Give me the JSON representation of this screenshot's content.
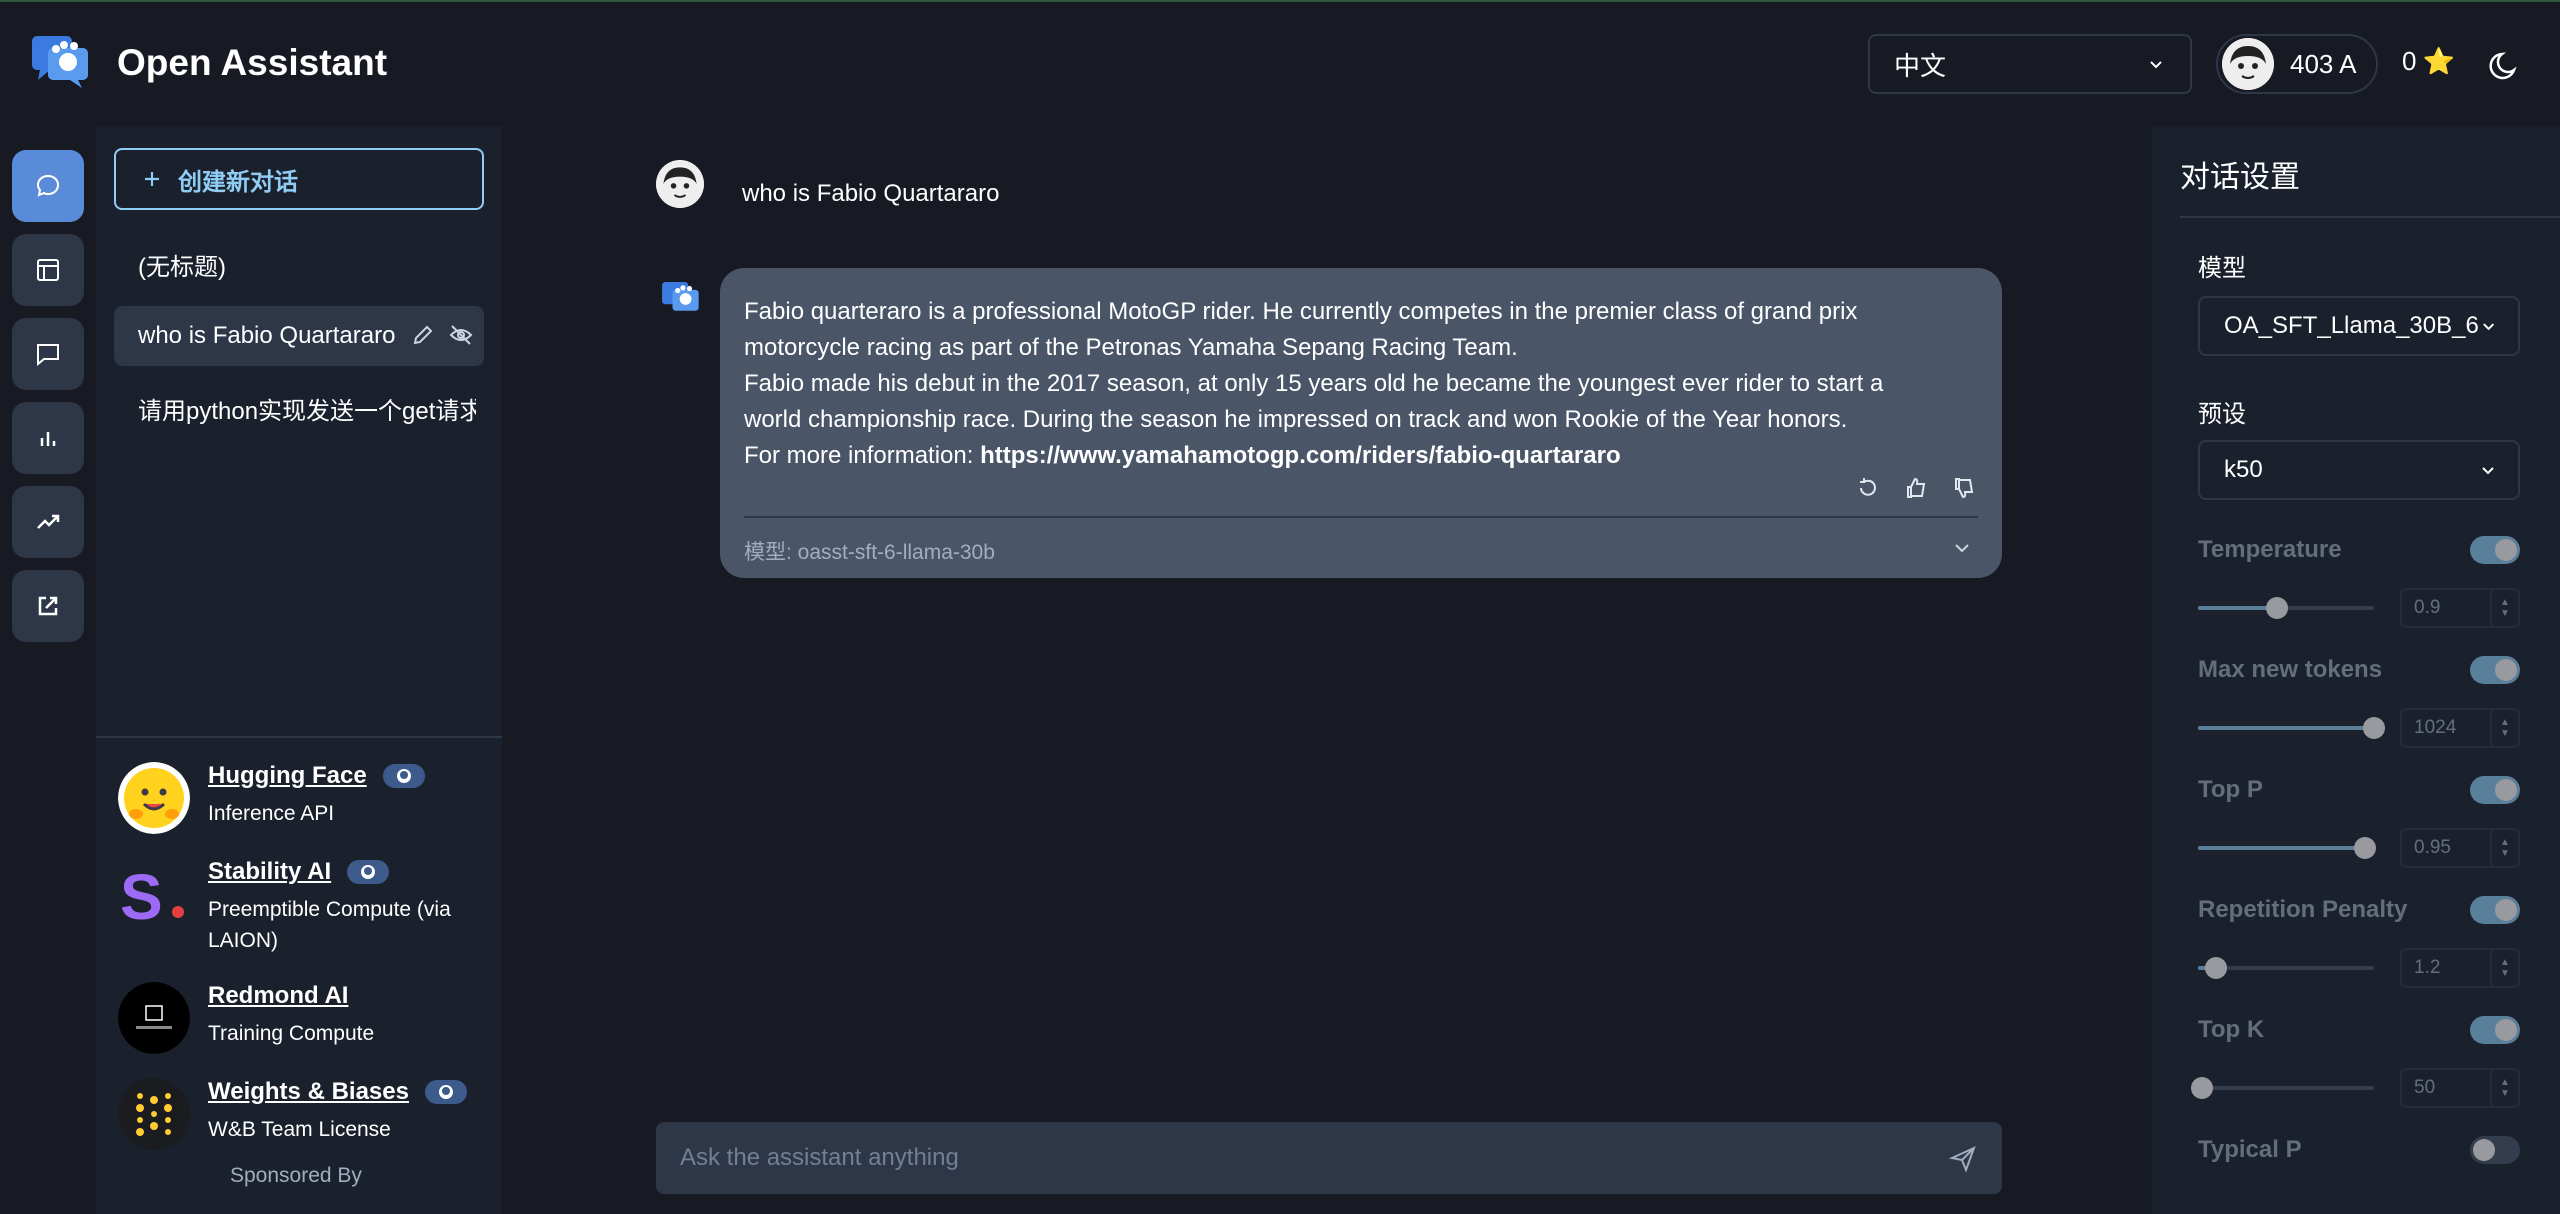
{
  "header": {
    "app_title": "Open Assistant",
    "language": "中文",
    "user_name": "403 A",
    "score": "0",
    "star": "⭐"
  },
  "sidebar": {
    "new_chat_label": "创建新对话",
    "chats": [
      {
        "title": "(无标题)"
      },
      {
        "title": "who is Fabio Quartararo"
      },
      {
        "title": "请用python实现发送一个get请求"
      }
    ],
    "sponsors": [
      {
        "name": "Hugging Face",
        "desc": "Inference API"
      },
      {
        "name": "Stability AI",
        "desc": "Preemptible Compute (via LAION)"
      },
      {
        "name": "Redmond AI",
        "desc": "Training Compute"
      },
      {
        "name": "Weights & Biases",
        "desc": "W&B Team License"
      }
    ],
    "sponsored_by": "Sponsored By"
  },
  "conversation": {
    "user_message": "who is Fabio Quartararo",
    "assistant_lines": [
      "Fabio quarteraro is a professional MotoGP rider. He currently competes in the premier class of grand prix",
      "motorcycle racing as part of the Petronas Yamaha Sepang Racing Team.",
      "Fabio made his debut in the 2017 season, at only 15 years old he became the youngest ever rider to start a",
      "world championship race. During the season he impressed on track and won Rookie of the Year honors."
    ],
    "more_info_prefix": "For more information: ",
    "more_info_link": "https://www.yamahamotogp.com/riders/fabio-quartararo",
    "model_label": "模型: oasst-sft-6-llama-30b",
    "composer_placeholder": "Ask the assistant anything"
  },
  "settings": {
    "title": "对话设置",
    "model_label": "模型",
    "model_value": "OA_SFT_Llama_30B_6",
    "preset_label": "预设",
    "preset_value": "k50",
    "params": [
      {
        "name": "Temperature",
        "value": "0.9",
        "enabled": true,
        "slider_fraction": 0.45
      },
      {
        "name": "Max new tokens",
        "value": "1024",
        "enabled": true,
        "slider_fraction": 1.0
      },
      {
        "name": "Top P",
        "value": "0.95",
        "enabled": true,
        "slider_fraction": 0.95
      },
      {
        "name": "Repetition Penalty",
        "value": "1.2",
        "enabled": true,
        "slider_fraction": 0.1
      },
      {
        "name": "Top K",
        "value": "50",
        "enabled": true,
        "slider_fraction": 0.02
      },
      {
        "name": "Typical P",
        "enabled": false
      }
    ]
  },
  "colors": {
    "accent": "#90cdf4",
    "active_rail": "#5a8bd8",
    "bubble": "#4a5568",
    "background": "#171923"
  }
}
